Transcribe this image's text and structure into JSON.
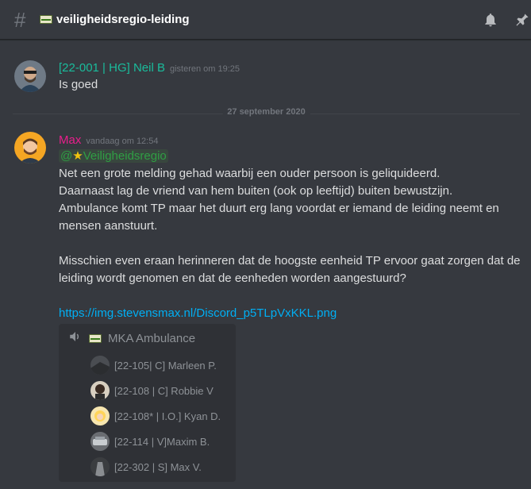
{
  "header": {
    "channel_name": "veiligheidsregio-leiding",
    "icons": [
      "hash-icon",
      "flag-icon",
      "bell-icon",
      "pin-icon"
    ]
  },
  "messages": [
    {
      "username": "[22-001 | HG] Neil B",
      "username_color": "#1abc9c",
      "timestamp": "gisteren om 19:25",
      "lines": [
        "Is goed"
      ]
    },
    {
      "username": "Max",
      "username_color": "#e91e8c",
      "timestamp": "vandaag om 12:54",
      "mention": "Veiligheidsregio",
      "lines": [
        "Net een grote melding gehad waarbij een ouder persoon is geliquideerd.",
        "Daarnaast lag de vriend van hem buiten (ook op leeftijd) buiten bewustzijn.",
        "Ambulance komt TP maar het duurt erg lang voordat er iemand de leiding neemt en",
        "mensen aanstuurt.",
        "Misschien even eraan herinneren dat de hoogste eenheid TP ervoor gaat zorgen dat de",
        "leiding wordt genomen en dat de eenheden worden aangestuurd?"
      ],
      "link": "https://img.stevensmax.nl/Discord_p5TLpVxKKL.png"
    }
  ],
  "divider_date": "27 september 2020",
  "voice_channel": {
    "name": "MKA Ambulance",
    "members": [
      "[22-105| C] Marleen P.",
      "[22-108 | C] Robbie V",
      "[22-108* | I.O.] Kyan D.",
      "[22-114 | V]Maxim B.",
      "[22-302 | S] Max V."
    ]
  },
  "colors": {
    "background": "#36393f",
    "embed": "#2f3136",
    "link": "#00aff4",
    "mention": "#2f9e44"
  }
}
